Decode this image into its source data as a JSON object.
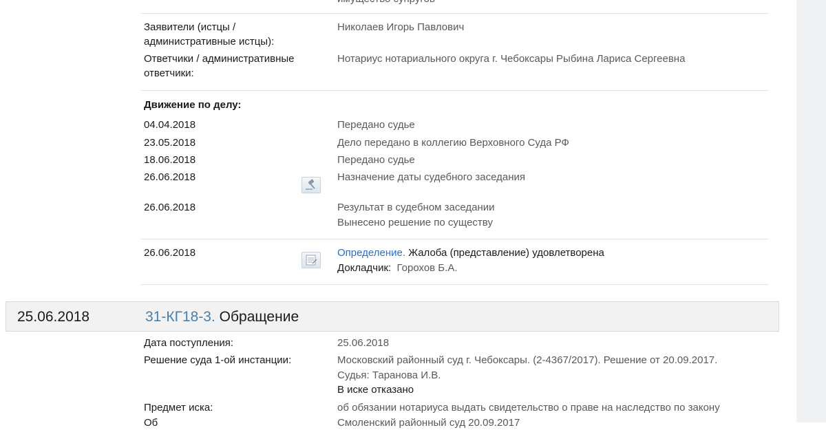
{
  "top_cut_text": "имущество супругов",
  "parties": {
    "applicants_label_line1": "Заявители (истцы /",
    "applicants_label_line2": "административные истцы):",
    "applicants_value": "Николаев Игорь Павлович",
    "respondents_label_line1": "Ответчики / административные",
    "respondents_label_line2": "ответчики:",
    "respondents_value": "Нотариус нотариального округа г. Чебоксары Рыбина Лариса Сергеевна"
  },
  "movement": {
    "heading": "Движение по делу:",
    "events": [
      {
        "date": "04.04.2018",
        "text": "Передано судье"
      },
      {
        "date": "23.05.2018",
        "text": "Дело передано в коллегию Верховного Суда РФ"
      },
      {
        "date": "18.06.2018",
        "text": "Передано судье"
      },
      {
        "date": "26.06.2018",
        "text": "Назначение даты судебного заседания",
        "icon": "gavel-icon"
      },
      {
        "date": "26.06.2018",
        "text": "Результат в судебном заседании",
        "text2": "Вынесено решение по существу"
      }
    ],
    "decision": {
      "date": "26.06.2018",
      "link": "Определение.",
      "text": "Жалоба (представление) удовлетворена",
      "reporter_label": "Докладчик:",
      "reporter_value": "Горохов Б.А.",
      "icon": "document-icon"
    }
  },
  "case2": {
    "date": "25.06.2018",
    "number": "31-КГ18-3.",
    "type": "Обращение",
    "received_label": "Дата поступления:",
    "received_value": "25.06.2018",
    "first_instance_label": "Решение суда 1-ой инстанции:",
    "first_instance_line1": "Московский районный суд г. Чебоксары. (2-4367/2017).  Решение от 20.09.2017.",
    "first_instance_line2": "Судья: Таранова И.В.",
    "first_instance_result": "В иске отказано",
    "subject_label": "Предмет иска:",
    "subject_value": "об обязании нотариуса выдать свидетельство о праве на наследство по закону",
    "cut_label": "Об",
    "cut_value": "Смоленский районный суд   20.09.2017"
  }
}
